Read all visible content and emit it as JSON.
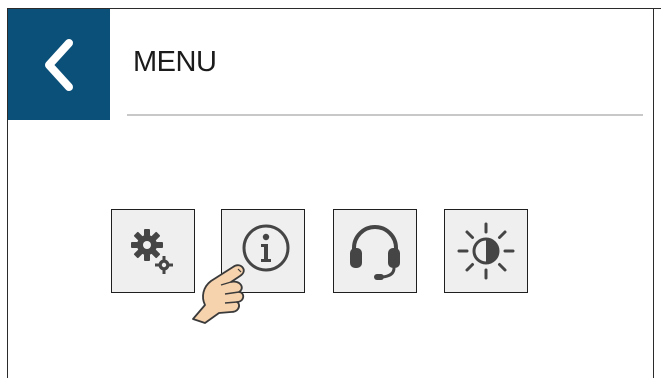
{
  "header": {
    "title": "MENU",
    "back_icon": "chevron-left-icon"
  },
  "colors": {
    "header_accent": "#0b5079",
    "tile_background": "#efefef",
    "icon_color": "#454545"
  },
  "menu": {
    "items": [
      {
        "name": "settings",
        "icon": "gears-icon"
      },
      {
        "name": "information",
        "icon": "info-icon"
      },
      {
        "name": "support",
        "icon": "headset-icon"
      },
      {
        "name": "brightness",
        "icon": "brightness-icon"
      }
    ]
  },
  "overlay": {
    "icon": "pointing-hand-icon"
  }
}
